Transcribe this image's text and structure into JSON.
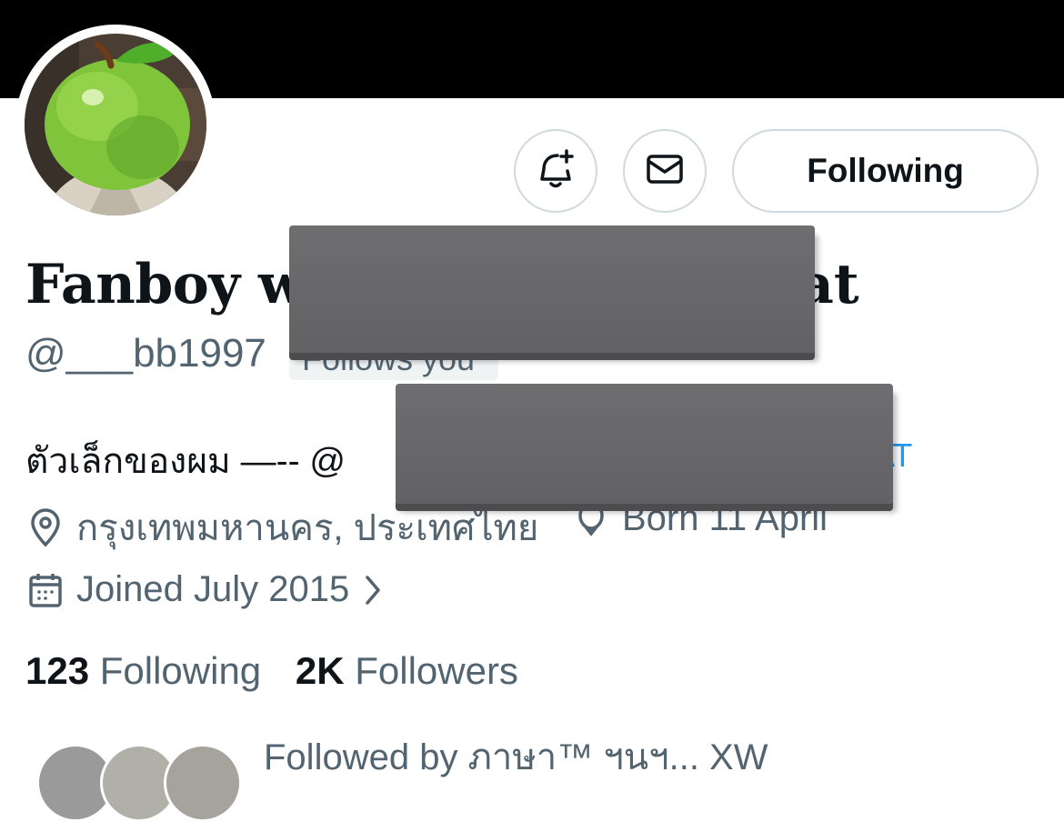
{
  "profile": {
    "display_name_start": "Fanboy w",
    "display_name_end": "at",
    "handle": "@___bb1997",
    "follows_you_badge": "Follows you",
    "bio_start": "ตัวเล็กของผม —-- @",
    "bio_end": "AT",
    "location": "กรุงเทพมหานคร, ประเทศไทย",
    "birthday": "Born 11 April",
    "joined": "Joined July 2015"
  },
  "actions": {
    "notify_icon": "bell-plus-icon",
    "message_icon": "envelope-icon",
    "follow_label": "Following"
  },
  "stats": {
    "following_count": "123",
    "following_label": "Following",
    "followers_count": "2K",
    "followers_label": "Followers"
  },
  "followed_by": {
    "text": "Followed by ภาษา™ ฯนฯ... XW"
  },
  "colors": {
    "banner": "#000000",
    "accent_link": "#1d9bf0",
    "muted_text": "#536471",
    "border": "#cfd9de"
  }
}
